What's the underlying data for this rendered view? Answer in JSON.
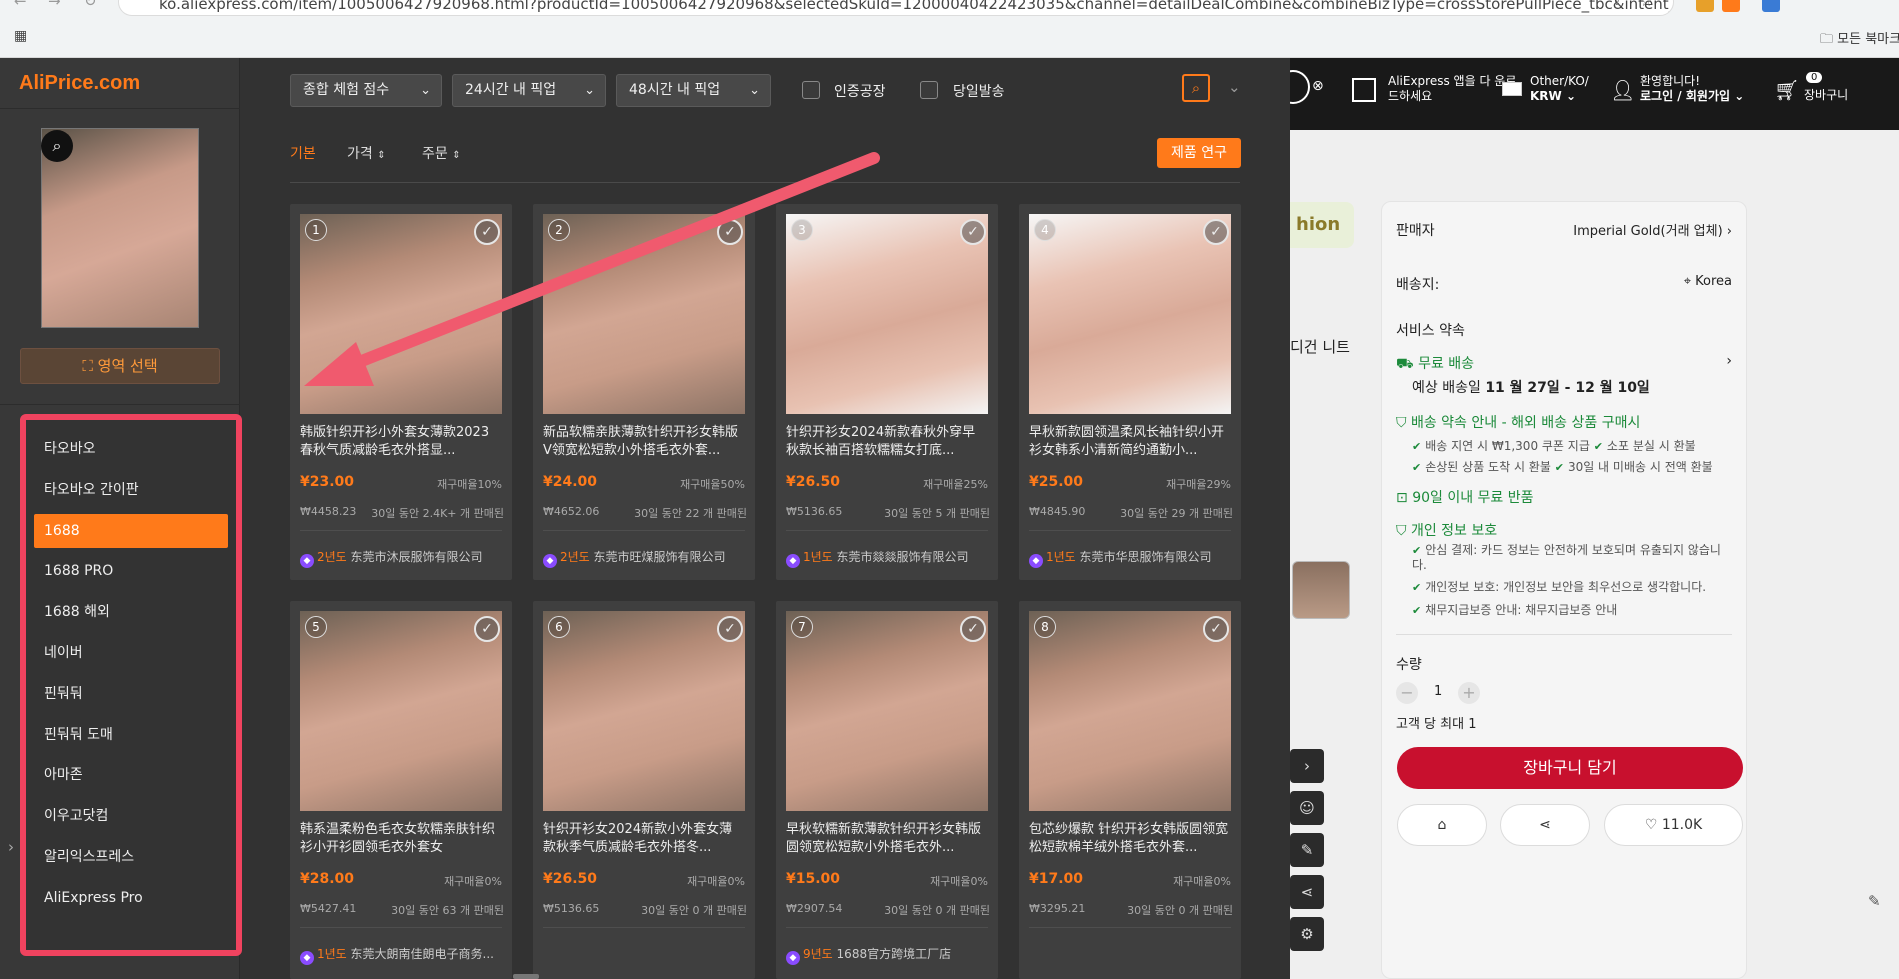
{
  "browser": {
    "url": "ko.aliexpress.com/item/1005006427920968.html?productId=1005006427920968&selectedSkuId=12000040422423035&channel=detailDealCombine&combineBizType=crossStorePullPiece_tbc&intent_extra_sku_ro...",
    "bookmarks_folder": "모든 북마크"
  },
  "aliexpress": {
    "app_download": "AliExpress 앱을 다 운로드하세요",
    "region": "Other/KO/",
    "currency": "KRW",
    "welcome": "환영합니다!",
    "login": "로그인 / 회원가입",
    "cart_label": "장바구니",
    "cart_count": "0",
    "fashion_tag": "hion",
    "knit_text": "디건 니트",
    "seller_label": "판매자",
    "seller_name": "Imperial Gold(거래 업체)",
    "ship_to_label": "배송지:",
    "ship_to_value": "Korea",
    "service_label": "서비스 약속",
    "free_shipping": "무료 배송",
    "eta_label": "예상 배송일",
    "eta_value": "11 월 27일 - 12 월 10일",
    "delivery_guarantee": "배송 약속 안내 - 해외 배송 상품 구매시",
    "delay_item": "배송 지연 시 ₩1,300 쿠폰 지급",
    "lost_item": "소포 분실 시 환불",
    "damaged_item": "손상된 상품 도착 시 환불",
    "no_delivery_item": "30일 내 미배송 시 전액 환불",
    "free_return": "90일 이내 무료 반품",
    "privacy_label": "개인 정보 보호",
    "privacy_1": "안심 결제: 카드 정보는 안전하게 보호되며 유출되지 않습니다.",
    "privacy_2": "개인정보 보호: 개인정보 보안을 최우선으로 생각합니다.",
    "privacy_3": "채무지급보증 안내: 채무지급보증 안내",
    "qty_label": "수량",
    "qty_value": "1",
    "qty_max": "고객 당 최대 1",
    "cart_button": "장바구니 담기",
    "wish_count": "11.0K"
  },
  "aliprice": {
    "logo": "AliPrice.com",
    "area_select": "영역 선택",
    "sites": [
      "타오바오",
      "타오바오 간이판",
      "1688",
      "1688 PRO",
      "1688 해외",
      "네이버",
      "핀둬둬",
      "핀둬둬 도매",
      "아마존",
      "이우고닷컴",
      "알리익스프레스",
      "AliExpress Pro"
    ],
    "active_site_index": 2,
    "filters": {
      "score": "종합 체험 점수",
      "pick24": "24시간 내 픽업",
      "pick48": "48시간 내 픽업",
      "certified": "인증공장",
      "same_day": "당일발송"
    },
    "sort": {
      "basic": "기본",
      "price": "가격",
      "orders": "주문",
      "research": "제품 연구"
    },
    "products": [
      {
        "num": "1",
        "title": "韩版针织开衫小外套女薄款2023春秋气质减龄毛衣外搭显...",
        "price": "¥23.00",
        "rebuy": "재구매율10%",
        "krw": "₩4458.23",
        "sold": "30일 동안 2.4K+ 개 판매된",
        "years": "2년도",
        "shop": "东莞市沐辰服饰有限公司"
      },
      {
        "num": "2",
        "title": "新品软糯亲肤薄款针织开衫女韩版V领宽松短款小外搭毛衣外套...",
        "price": "¥24.00",
        "rebuy": "재구매율50%",
        "krw": "₩4652.06",
        "sold": "30일 동안 22 개 판매된",
        "years": "2년도",
        "shop": "东莞市旺煤服饰有限公司"
      },
      {
        "num": "3",
        "title": "针织开衫女2024新款春秋外穿早秋款长袖百搭软糯糯女打底...",
        "price": "¥26.50",
        "rebuy": "재구매율25%",
        "krw": "₩5136.65",
        "sold": "30일 동안 5 개 판매된",
        "years": "1년도",
        "shop": "东莞市燚燚服饰有限公司"
      },
      {
        "num": "4",
        "title": "早秋新款圆领温柔风长袖针织小开衫女韩系小清新简约通勤小...",
        "price": "¥25.00",
        "rebuy": "재구매율29%",
        "krw": "₩4845.90",
        "sold": "30일 동안 29 개 판매된",
        "years": "1년도",
        "shop": "东莞市华思服饰有限公司"
      },
      {
        "num": "5",
        "title": "韩系温柔粉色毛衣女软糯亲肤针织衫小开衫圆领毛衣外套女",
        "price": "¥28.00",
        "rebuy": "재구매율0%",
        "krw": "₩5427.41",
        "sold": "30일 동안 63 개 판매된",
        "years": "1년도",
        "shop": "东莞大朗南佳朗电子商务..."
      },
      {
        "num": "6",
        "title": "针织开衫女2024新款小外套女薄款秋季气质减龄毛衣外搭冬...",
        "price": "¥26.50",
        "rebuy": "재구매율0%",
        "krw": "₩5136.65",
        "sold": "30일 동안 0 개 판매된",
        "years": "",
        "shop": ""
      },
      {
        "num": "7",
        "title": "早秋软糯新款薄款针织开衫女韩版圆领宽松短款小外搭毛衣外...",
        "price": "¥15.00",
        "rebuy": "재구매율0%",
        "krw": "₩2907.54",
        "sold": "30일 동안 0 개 판매된",
        "years": "9년도",
        "shop": "1688官方跨境工厂店"
      },
      {
        "num": "8",
        "title": "包芯纱爆款 针织开衫女韩版圆领宽松短款棉羊绒外搭毛衣外套...",
        "price": "¥17.00",
        "rebuy": "재구매율0%",
        "krw": "₩3295.21",
        "sold": "30일 동안 0 개 판매된",
        "years": "",
        "shop": ""
      }
    ]
  },
  "colors": {
    "accent": "#ff7a1a",
    "highlight_border": "#f0435f",
    "ae_red": "#c8102e",
    "arrow": "#f05a6e"
  }
}
